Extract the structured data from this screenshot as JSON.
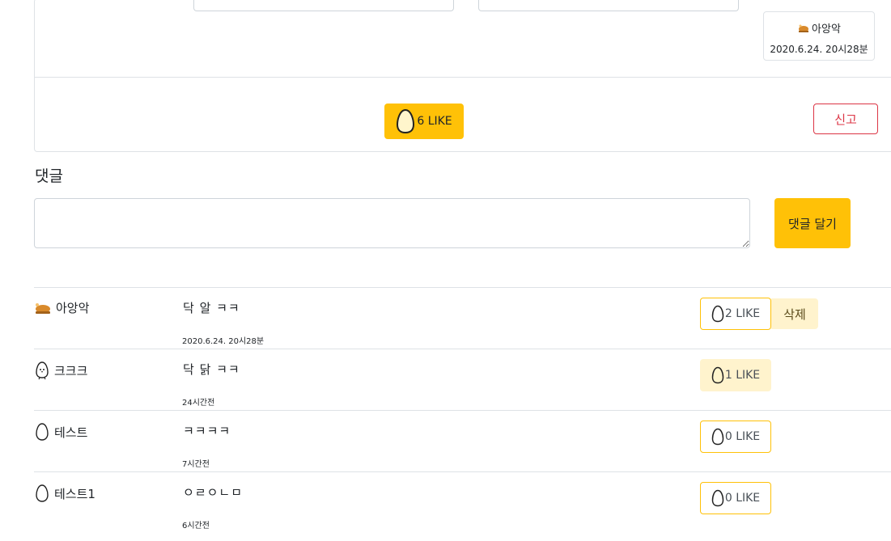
{
  "post": {
    "author": "아앙악",
    "date": "2020.6.24. 20시28분",
    "like_label": "6 LIKE",
    "report_label": "신고"
  },
  "comments_section": {
    "heading": "댓글",
    "input_value": "",
    "submit_label": "댓글 달기"
  },
  "comments": [
    {
      "author": "아앙악",
      "avatar": "chicken-icon",
      "text": "닥 알 ㅋㅋ",
      "time": "2020.6.24. 20시28분",
      "like_label": "2 LIKE",
      "delete_label": "삭제"
    },
    {
      "author": "크크크",
      "avatar": "chick-icon",
      "text": "닥 닭 ㅋㅋ",
      "time": "24시간전",
      "like_label": "1 LIKE"
    },
    {
      "author": "테스트",
      "avatar": "egg-icon",
      "text": "ㅋㅋㅋㅋ",
      "time": "7시간전",
      "like_label": "0 LIKE"
    },
    {
      "author": "테스트1",
      "avatar": "egg-icon",
      "text": "ㅇㄹㅇㄴㅁ",
      "time": "6시간전",
      "like_label": "0 LIKE"
    }
  ],
  "colors": {
    "accent": "#ffc107",
    "accent_light": "#fff3cd",
    "danger": "#dc3545",
    "border": "#dee2e6"
  }
}
